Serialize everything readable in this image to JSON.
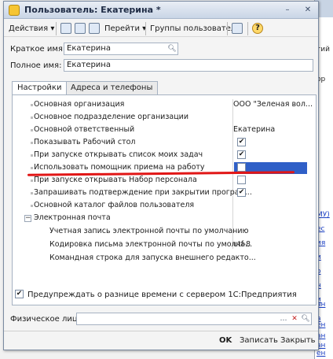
{
  "window": {
    "title": "Пользователь: Екатерина *",
    "controls": {
      "minimize": "–",
      "close": "✕"
    }
  },
  "toolbar": {
    "actions": "Действия ▾",
    "goto": "Перейти ▾",
    "user_groups": "Группы пользователя",
    "help": "?"
  },
  "form": {
    "short_name_label": "Краткое имя:",
    "short_name_value": "Екатерина",
    "full_name_label": "Полное имя:",
    "full_name_value": "Екатерина"
  },
  "tabs": [
    {
      "label": "Настройки",
      "active": true
    },
    {
      "label": "Адреса и телефоны",
      "active": false
    }
  ],
  "settings": {
    "rows": [
      {
        "name": "Основная организация",
        "value": "ООО \"Зеленая вол..."
      },
      {
        "name": "Основное подразделение организации",
        "value": ""
      },
      {
        "name": "Основной ответственный",
        "value": "Екатерина"
      },
      {
        "name": "Показывать Рабочий стол",
        "check": "✔"
      },
      {
        "name": "При запуске открывать список моих задач",
        "check": "✔"
      },
      {
        "name": "Использовать помощник приема на работу",
        "check": ""
      },
      {
        "name": "При запуске открывать Набор персонала",
        "check": ""
      },
      {
        "name": "Запрашивать подтверждение при закрытии програм...",
        "check": "✔"
      },
      {
        "name": "Основной каталог файлов пользователя",
        "value": ""
      },
      {
        "name": "Электронная почта",
        "value": "",
        "group_toggle": "−"
      },
      {
        "name": "Учетная запись электронной почты по умолчанию",
        "value": ""
      },
      {
        "name": "Кодировка письма электронной почты по умолча...",
        "value": "utf-8"
      },
      {
        "name": "Командная строка для запуска внешнего редакто...",
        "value": ""
      }
    ]
  },
  "time_warning": {
    "label": "Предупреждать о разнице времени с сервером 1С:Предприятия",
    "check": "✔"
  },
  "physical_person": {
    "label": "Физическое лицо:",
    "value": "",
    "select_btn": "…",
    "clear_btn": "✕"
  },
  "footer": {
    "ok": "OK",
    "save": "Записать",
    "close": "Закрыть"
  },
  "background_window": {
    "text_items": [
      "тий",
      "ор"
    ],
    "link_items": [
      "МУ)",
      "ес",
      "ия",
      "и",
      "о",
      "н",
      "и",
      "ан",
      "а",
      "ен",
      "ан",
      "ан",
      "ен"
    ]
  },
  "colors": {
    "selection": "#2f5fc7",
    "annotation_underline": "#e11616"
  }
}
